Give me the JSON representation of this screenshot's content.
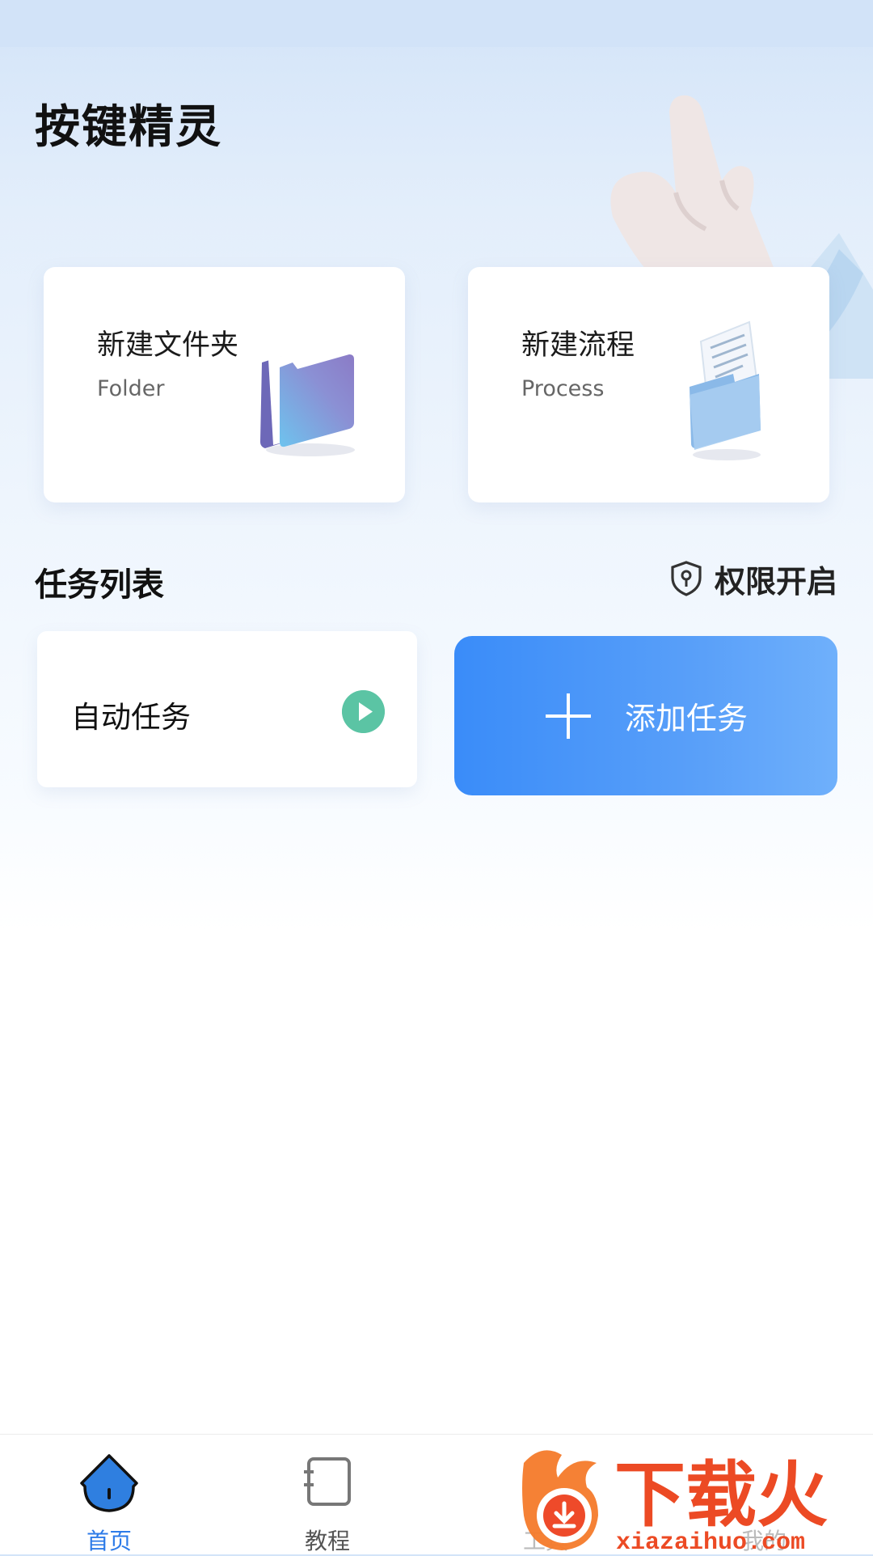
{
  "app": {
    "title": "按键精灵"
  },
  "cards": {
    "folder": {
      "title": "新建文件夹",
      "subtitle": "Folder"
    },
    "process": {
      "title": "新建流程",
      "subtitle": "Process"
    }
  },
  "tasks": {
    "section_title": "任务列表",
    "permission_label": "权限开启",
    "items": [
      {
        "name": "自动任务"
      }
    ],
    "add_label": "添加任务"
  },
  "nav": {
    "items": [
      {
        "label": "首页",
        "icon": "home-icon",
        "active": true
      },
      {
        "label": "教程",
        "icon": "tutorial-icon",
        "active": false
      },
      {
        "label": "工具",
        "icon": "tools-icon",
        "active": false
      },
      {
        "label": "我的",
        "icon": "profile-icon",
        "active": false
      }
    ]
  },
  "watermark": {
    "text": "下载火",
    "url_text": "xiazaihuo.com"
  },
  "colors": {
    "accent": "#2d7be8",
    "add_button": "#3a8cf9",
    "play": "#5bc4a4"
  }
}
